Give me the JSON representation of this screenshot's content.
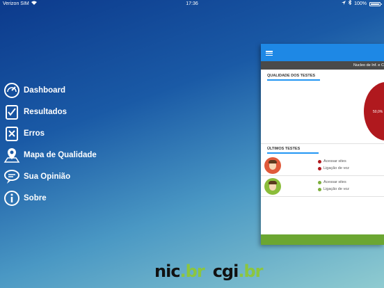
{
  "status_bar": {
    "carrier": "Verizon SIM",
    "time": "17:36",
    "battery": "100%"
  },
  "menu": {
    "items": [
      {
        "label": "Dashboard",
        "icon": "dashboard-icon"
      },
      {
        "label": "Resultados",
        "icon": "results-icon"
      },
      {
        "label": "Erros",
        "icon": "errors-icon"
      },
      {
        "label": "Mapa de Qualidade",
        "icon": "map-pin-icon"
      },
      {
        "label": "Sua Opinião",
        "icon": "chat-icon"
      },
      {
        "label": "Sobre",
        "icon": "info-icon"
      }
    ]
  },
  "logos": {
    "nic": "nic",
    "nic_suffix": "br",
    "cgi": "cgi",
    "cgi_suffix": "br"
  },
  "preview": {
    "header_text": "Nucleo de Inf. e C",
    "quality_section": "QUALIDADE DOS TESTES",
    "pie_label": "50,0%",
    "recent_section": "ÚLTIMOS TESTES",
    "tests": [
      {
        "line1": "Acessar sites",
        "line2": "Ligação de voz",
        "status_color": "#b0191e",
        "avatar": "red"
      },
      {
        "line1": "Acessar sites",
        "line2": "Ligação de voz",
        "status_color": "#7cae3c",
        "avatar": "green"
      }
    ]
  },
  "colors": {
    "accent_blue": "#1e88e5",
    "accent_green": "#6ba632",
    "error_red": "#b0191e"
  }
}
